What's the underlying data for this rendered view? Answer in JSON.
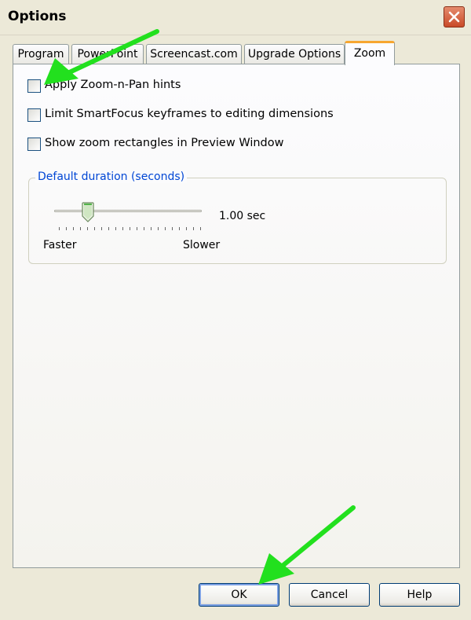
{
  "window": {
    "title": "Options",
    "close_icon": "close-x-icon"
  },
  "tabs": [
    {
      "label": "Program",
      "active": false
    },
    {
      "label": "PowerPoint",
      "active": false
    },
    {
      "label": "Screencast.com",
      "active": false
    },
    {
      "label": "Upgrade Options",
      "active": false
    },
    {
      "label": "Zoom",
      "active": true
    }
  ],
  "zoom_tab": {
    "checkboxes": [
      {
        "label": "Apply Zoom-n-Pan hints",
        "checked": false
      },
      {
        "label": "Limit SmartFocus keyframes to editing dimensions",
        "checked": false
      },
      {
        "label": "Show zoom rectangles in Preview Window",
        "checked": false
      }
    ],
    "duration_group": {
      "legend": "Default duration (seconds)",
      "value_text": "1.00 sec",
      "min_label": "Faster",
      "max_label": "Slower",
      "slider_position_fraction": 0.23
    }
  },
  "buttons": {
    "ok": "OK",
    "cancel": "Cancel",
    "help": "Help"
  },
  "annotations": {
    "arrow_color": "#22e01e"
  },
  "colors": {
    "tab_highlight": "#f7a630",
    "group_legend": "#0046d5",
    "close_button": "#c94a28"
  }
}
